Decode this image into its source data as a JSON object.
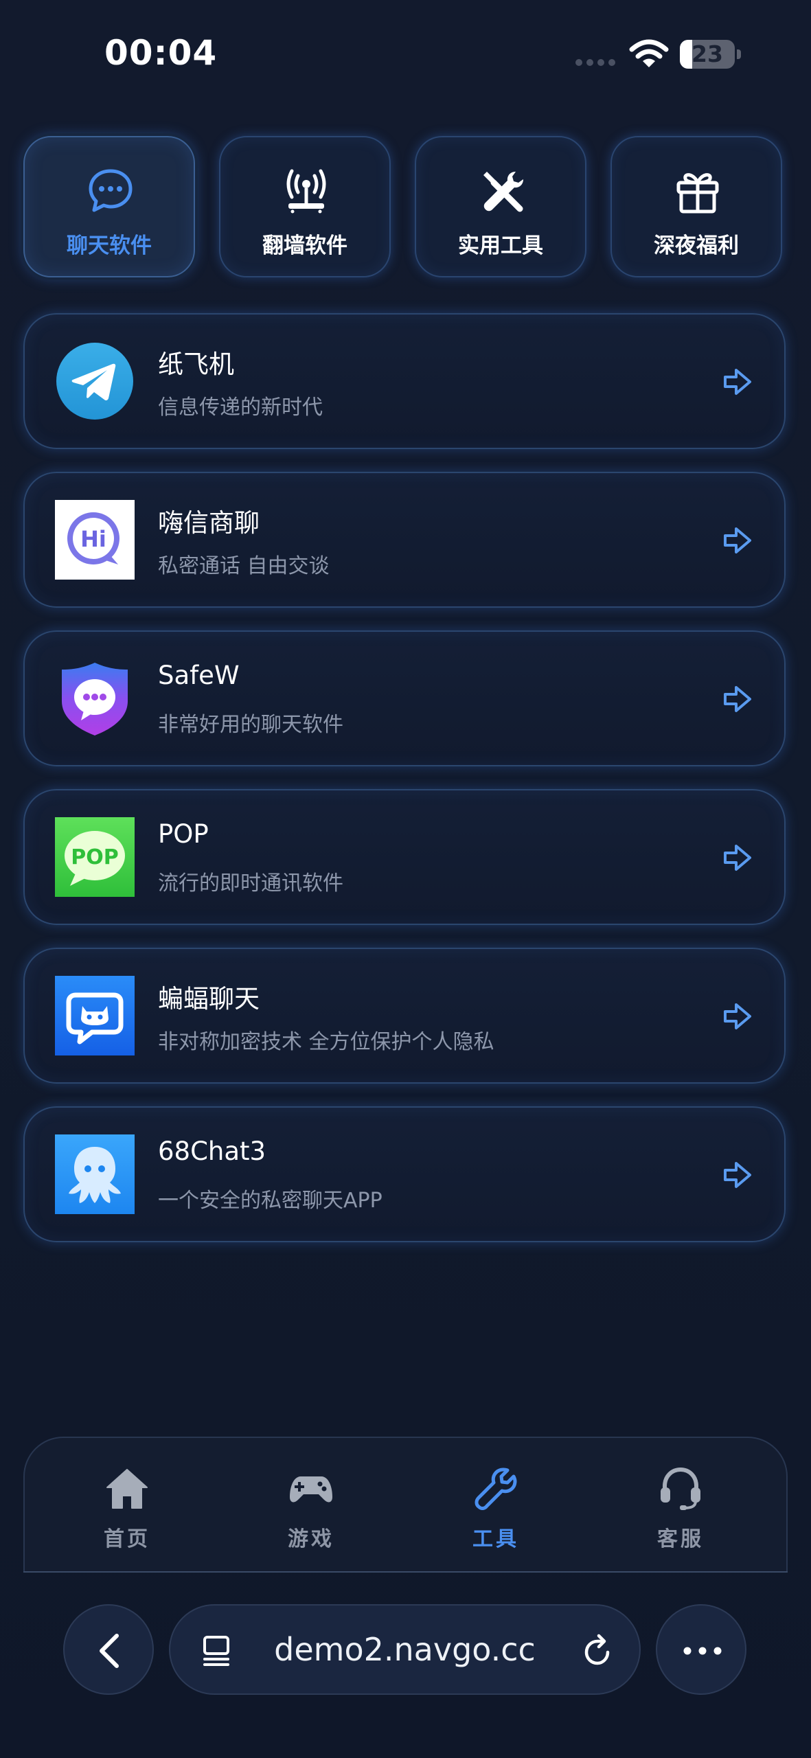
{
  "status_bar": {
    "time": "00:04",
    "battery_level": "23",
    "icons": [
      "signal-dots-icon",
      "wifi-icon",
      "battery-icon"
    ]
  },
  "categories": [
    {
      "label": "聊天软件",
      "icon": "chat-bubble-icon",
      "active": true
    },
    {
      "label": "翻墙软件",
      "icon": "antenna-icon",
      "active": false
    },
    {
      "label": "实用工具",
      "icon": "tools-icon",
      "active": false
    },
    {
      "label": "深夜福利",
      "icon": "gift-icon",
      "active": false
    }
  ],
  "apps": [
    {
      "name": "纸飞机",
      "desc": "信息传递的新时代",
      "icon": "telegram-icon"
    },
    {
      "name": "嗨信商聊",
      "desc": "私密通话 自由交谈",
      "icon": "hi-chat-icon"
    },
    {
      "name": "SafeW",
      "desc": "非常好用的聊天软件",
      "icon": "safew-shield-icon"
    },
    {
      "name": "POP",
      "desc": "流行的即时通讯软件",
      "icon": "pop-icon",
      "icon_text": "POP"
    },
    {
      "name": "蝙蝠聊天",
      "desc": "非对称加密技术 全方位保护个人隐私",
      "icon": "bat-chat-icon"
    },
    {
      "name": "68Chat3",
      "desc": "一个安全的私密聊天APP",
      "icon": "octopus-icon"
    }
  ],
  "bottom_nav": [
    {
      "label": "首页",
      "icon": "home-icon",
      "active": false
    },
    {
      "label": "游戏",
      "icon": "gamepad-icon",
      "active": false
    },
    {
      "label": "工具",
      "icon": "wrench-icon",
      "active": true
    },
    {
      "label": "客服",
      "icon": "headset-icon",
      "active": false
    }
  ],
  "browser": {
    "url": "demo2.navgo.cc",
    "icons": [
      "back-chevron-icon",
      "tab-overview-icon",
      "reload-icon",
      "more-dots-icon"
    ]
  },
  "colors": {
    "background": "#111a2c",
    "accent_blue": "#4a8ff0",
    "card_border": "#2b466e",
    "muted_text": "#8d97ab"
  }
}
